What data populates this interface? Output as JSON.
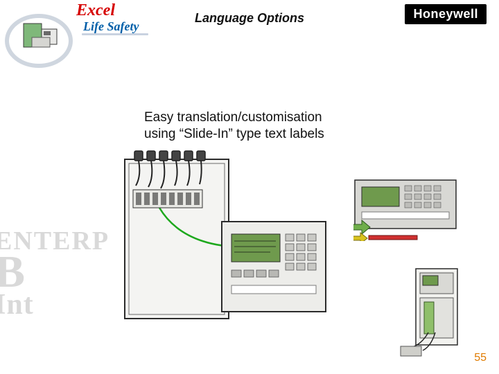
{
  "header": {
    "brand_line1": "Excel",
    "brand_line2": "Life Safety",
    "slide_title": "Language Options",
    "logo_text": "Honeywell"
  },
  "watermark": {
    "line1": "ENTERP",
    "line2": "B",
    "line3": "Int"
  },
  "body": {
    "line1": "Easy translation/customisation",
    "line2": "using “Slide-In” type text labels"
  },
  "page_number": "55",
  "icons": {
    "corner_device": "panel-device-icon",
    "main_illustration": "cabinet-panel-illustration",
    "panel_front": "panel-front-illustration",
    "panel_side": "panel-mount-illustration"
  }
}
